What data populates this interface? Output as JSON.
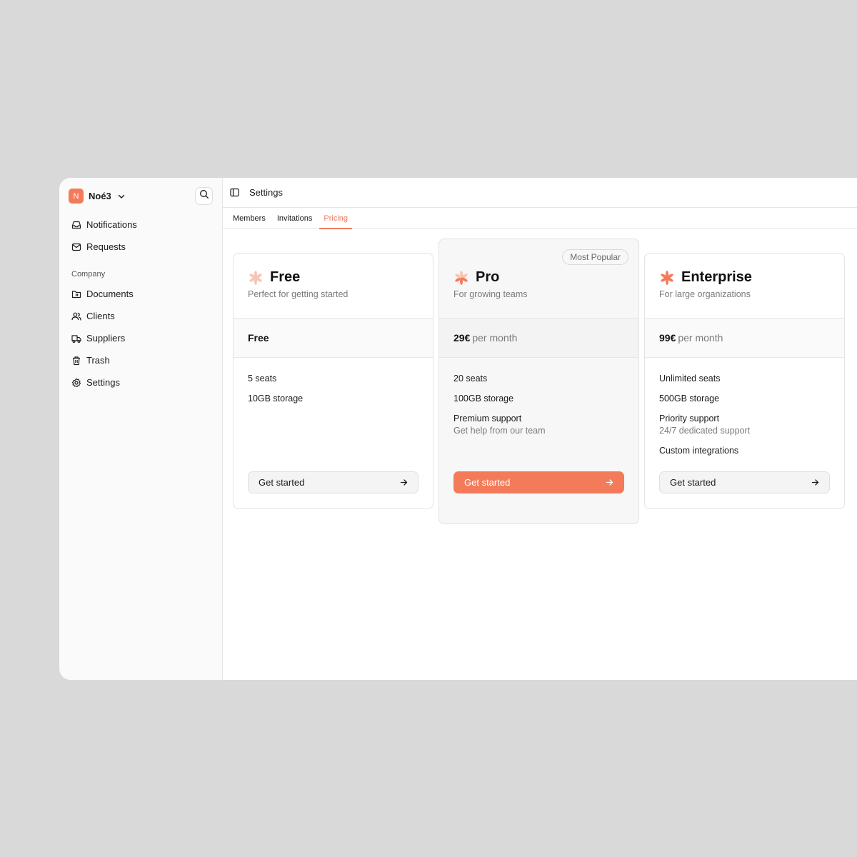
{
  "workspace": {
    "initial": "N",
    "name": "Noé3"
  },
  "sidebar": {
    "top_items": [
      {
        "label": "Notifications",
        "icon": "inbox-icon"
      },
      {
        "label": "Requests",
        "icon": "mail-icon"
      }
    ],
    "section_label": "Company",
    "company_items": [
      {
        "label": "Documents",
        "icon": "folder-icon"
      },
      {
        "label": "Clients",
        "icon": "users-icon"
      },
      {
        "label": "Suppliers",
        "icon": "truck-icon"
      },
      {
        "label": "Trash",
        "icon": "trash-icon"
      },
      {
        "label": "Settings",
        "icon": "gear-icon"
      }
    ]
  },
  "header": {
    "title": "Settings"
  },
  "tabs": [
    {
      "label": "Members",
      "active": false
    },
    {
      "label": "Invitations",
      "active": false
    },
    {
      "label": "Pricing",
      "active": true
    }
  ],
  "colors": {
    "accent": "#f47b5a"
  },
  "plans": [
    {
      "name": "Free",
      "subtitle": "Perfect for getting started",
      "price": "Free",
      "period": "",
      "features": [
        {
          "text": "5 seats",
          "note": ""
        },
        {
          "text": "10GB storage",
          "note": ""
        }
      ],
      "cta": "Get started"
    },
    {
      "name": "Pro",
      "subtitle": "For growing teams",
      "badge": "Most Popular",
      "price": "29€",
      "period": "per month",
      "features": [
        {
          "text": "20 seats",
          "note": ""
        },
        {
          "text": "100GB storage",
          "note": ""
        },
        {
          "text": "Premium support",
          "note": "Get help from our team"
        }
      ],
      "cta": "Get started"
    },
    {
      "name": "Enterprise",
      "subtitle": "For large organizations",
      "price": "99€",
      "period": "per month",
      "features": [
        {
          "text": "Unlimited seats",
          "note": ""
        },
        {
          "text": "500GB storage",
          "note": ""
        },
        {
          "text": "Priority support",
          "note": "24/7 dedicated support"
        },
        {
          "text": "Custom integrations",
          "note": ""
        }
      ],
      "cta": "Get started"
    }
  ]
}
